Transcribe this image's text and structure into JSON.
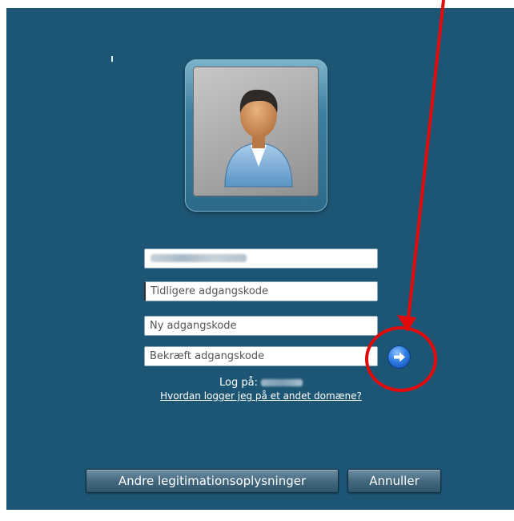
{
  "login": {
    "username_value": "",
    "old_password_placeholder": "Tidligere adgangskode",
    "new_password_placeholder": "Ny adgangskode",
    "confirm_password_placeholder": "Bekræft adgangskode",
    "log_on_label": "Log på:",
    "help_link": "Hvordan logger jeg på et andet domæne?"
  },
  "buttons": {
    "other_credentials": "Andre legitimationsoplysninger",
    "cancel": "Annuller",
    "submit_icon": "arrow-right-icon"
  },
  "colors": {
    "background": "#1d5674",
    "annotation": "#e10b0b",
    "submit": "#2f7de3"
  }
}
